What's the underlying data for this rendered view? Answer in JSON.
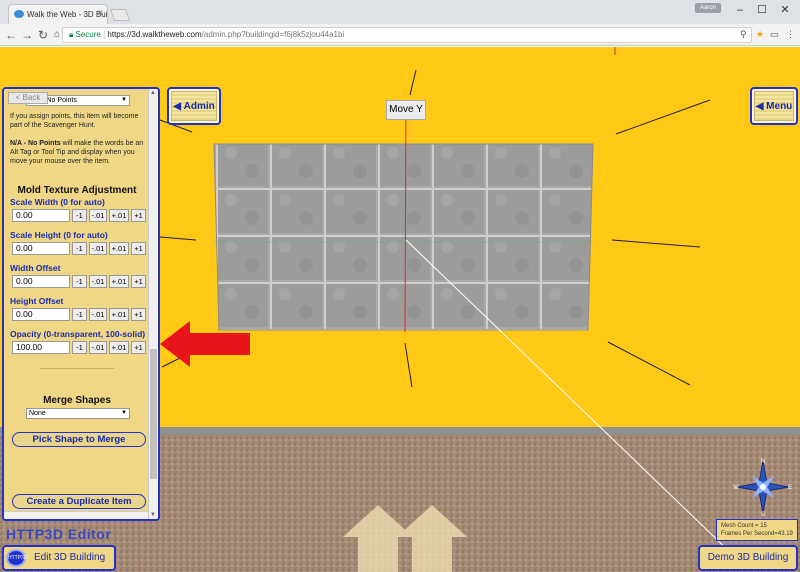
{
  "browser": {
    "tab_title": "Walk the Web - 3D Buildi",
    "tab_close": "×",
    "profile_label": "Aaron",
    "secure_label": "Secure",
    "url_host": "https://3d.walktheweb.com",
    "url_path": "/admin.php?buildingid=f6j8k5zjou44a1bi",
    "minimize": "–",
    "maximize": "☐",
    "close": "✕"
  },
  "overlay": {
    "admin_label": "Admin",
    "menu_label": "Menu",
    "move_y_label": "Move Y"
  },
  "panel": {
    "back_label": "< Back",
    "points_selected": "N/A - No Points",
    "info_text_1": "If you assign points, this item will become part of the Scavenger Hunt.",
    "info_text_2_bold": "N/A - No Points",
    "info_text_2_rest": " will make the words be an Alt Tag or Tool Tip and display when you move your mouse over the item.",
    "mold_title": "Mold Texture Adjustment",
    "fields": [
      {
        "label": "Scale Width (0 for auto)",
        "value": "0.00"
      },
      {
        "label": "Scale Height (0 for auto)",
        "value": "0.00"
      },
      {
        "label": "Width Offset",
        "value": "0.00"
      },
      {
        "label": "Height Offset",
        "value": "0.00"
      },
      {
        "label": "Opacity (0-transparent, 100-solid)",
        "value": "100.00"
      }
    ],
    "steps": [
      "-1",
      "-.01",
      "+.01",
      "+1"
    ],
    "merge_title": "Merge Shapes",
    "merge_selected": "None",
    "pick_shape_label": "Pick Shape to Merge",
    "duplicate_label": "Create a Duplicate Item"
  },
  "bottom": {
    "editor_title": "HTTP3D Editor",
    "logo_text": "HTTP3D",
    "edit_building_label": "Edit 3D Building",
    "demo_building_label": "Demo 3D Building",
    "stats_line1": "Mesh Count = 15",
    "stats_line2": "Frames Per Second=43.19"
  },
  "compass_letters": {
    "n": "N",
    "s": "S",
    "e": "E",
    "w": "W"
  },
  "colors": {
    "wall": "#ffc915",
    "panel_border": "#2431c8",
    "arrow": "#e8141c"
  }
}
